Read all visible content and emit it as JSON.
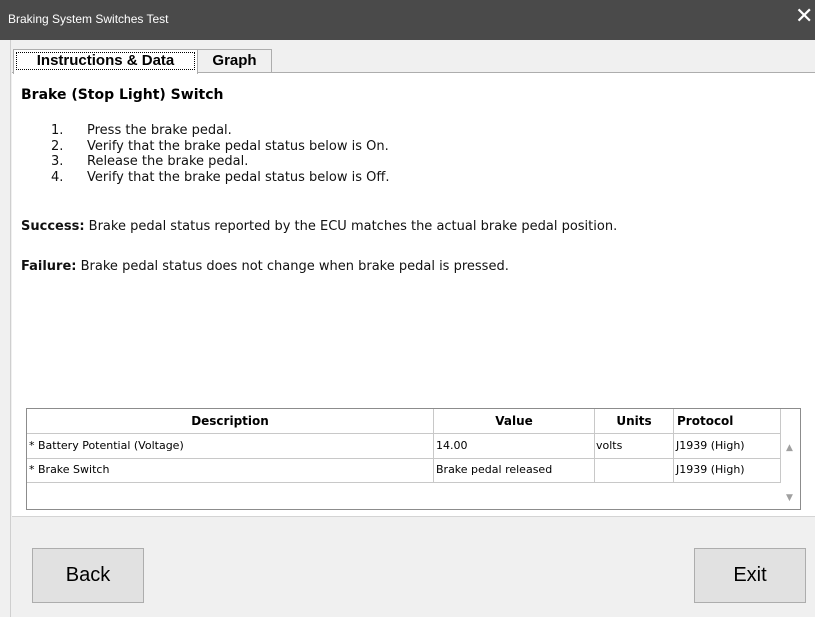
{
  "window": {
    "title": "Braking System Switches Test",
    "close_glyph": "✕"
  },
  "tabs": [
    {
      "label": "Instructions & Data"
    },
    {
      "label": "Graph"
    }
  ],
  "instructions": {
    "heading": "Brake (Stop Light) Switch",
    "steps": [
      {
        "num": "1.",
        "text": "Press the brake pedal."
      },
      {
        "num": "2.",
        "text": "Verify that the brake pedal status below is On."
      },
      {
        "num": "3.",
        "text": "Release the brake pedal."
      },
      {
        "num": "4.",
        "text": "Verify that the brake pedal status below is Off."
      }
    ],
    "success_label": "Success:",
    "success_text": "Brake pedal status reported by the ECU matches the actual brake pedal position.",
    "failure_label": "Failure:",
    "failure_text": "Brake pedal status does not change when brake pedal is pressed."
  },
  "table": {
    "columns": [
      "Description",
      "Value",
      "Units",
      "Protocol"
    ],
    "rows": [
      [
        "* Battery Potential (Voltage)",
        "14.00",
        "volts",
        "J1939 (High)"
      ],
      [
        "* Brake Switch",
        "Brake pedal released",
        "",
        "J1939 (High)"
      ]
    ],
    "scroll_up_icon": "▲",
    "scroll_down_icon": "▼"
  },
  "buttons": {
    "back": "Back",
    "exit": "Exit"
  }
}
